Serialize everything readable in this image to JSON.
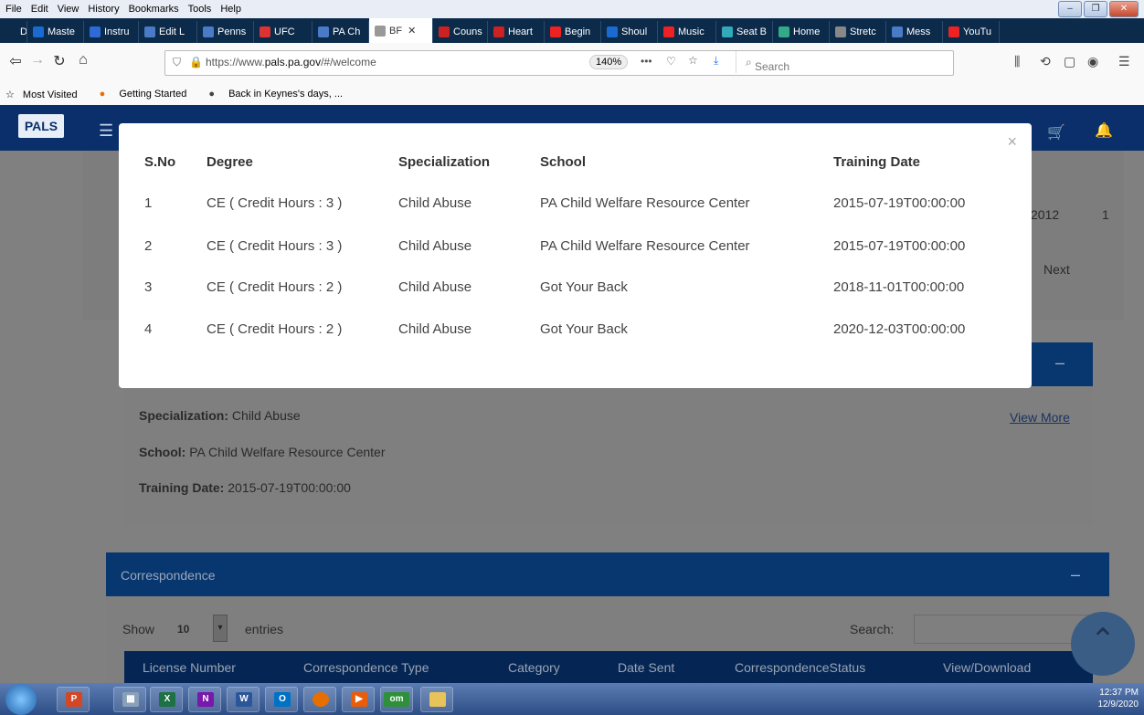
{
  "menu": [
    "File",
    "Edit",
    "View",
    "History",
    "Bookmarks",
    "Tools",
    "Help"
  ],
  "tabs": [
    {
      "label": "DA",
      "color": "#0c2a4a"
    },
    {
      "label": "Maste",
      "color": "#1a6bd1"
    },
    {
      "label": "Instru",
      "color": "#2f6bd6"
    },
    {
      "label": "Edit L",
      "color": "#4a7bc7"
    },
    {
      "label": "Penns",
      "color": "#4a7bc7"
    },
    {
      "label": "UFC",
      "color": "#d33"
    },
    {
      "label": "PA Ch",
      "color": "#4a7bc7"
    },
    {
      "label": "BF",
      "color": "#999",
      "active": true
    },
    {
      "label": "Couns",
      "color": "#c22"
    },
    {
      "label": "Heart",
      "color": "#c22"
    },
    {
      "label": "Begin",
      "color": "#e22"
    },
    {
      "label": "Shoul",
      "color": "#1a6bd1"
    },
    {
      "label": "Music",
      "color": "#e22"
    },
    {
      "label": "Seat B",
      "color": "#3ab"
    },
    {
      "label": "Home",
      "color": "#3a8"
    },
    {
      "label": "Stretc",
      "color": "#888"
    },
    {
      "label": "Mess",
      "color": "#4a7bc7"
    },
    {
      "label": "YouTu",
      "color": "#e22"
    }
  ],
  "browser": {
    "url_prefix": "https://www.",
    "url_host": "pals.pa.gov",
    "url_suffix": "/#/welcome",
    "zoom": "140%",
    "search_placeholder": "Search"
  },
  "bookmarks": [
    "Most Visited",
    "Getting Started",
    "Back in Keynes's days, ..."
  ],
  "app": {
    "logo": "PALS"
  },
  "modal": {
    "headers": [
      "S.No",
      "Degree",
      "Specialization",
      "School",
      "Training Date"
    ],
    "rows": [
      [
        "1",
        "CE ( Credit Hours : 3 )",
        "Child Abuse",
        "PA Child Welfare Resource Center",
        "2015-07-19T00:00:00"
      ],
      [
        "2",
        "CE ( Credit Hours : 3 )",
        "Child Abuse",
        "PA Child Welfare Resource Center",
        "2015-07-19T00:00:00"
      ],
      [
        "3",
        "CE ( Credit Hours : 2 )",
        "Child Abuse",
        "Got Your Back",
        "2018-11-01T00:00:00"
      ],
      [
        "4",
        "CE ( Credit Hours : 2 )",
        "Child Abuse",
        "Got Your Back",
        "2020-12-03T00:00:00"
      ]
    ],
    "close": "×"
  },
  "background": {
    "partial_year": "2012",
    "partial_num": "1",
    "next": "Next",
    "spec_label": "Specialization:",
    "spec_value": "Child Abuse",
    "school_label": "School:",
    "school_value": "PA Child Welfare Resource Center",
    "date_label": "Training Date:",
    "date_value": "2015-07-19T00:00:00",
    "view_more": "View More",
    "correspondence_title": "Correspondence",
    "show_label": "Show",
    "show_value": "10",
    "entries_label": "entries",
    "search_label": "Search:",
    "columns": [
      "License Number",
      "Correspondence Type",
      "Category",
      "Date Sent",
      "CorrespondenceStatus",
      "View/Download"
    ]
  },
  "taskbar": {
    "time": "12:37 PM",
    "date": "12/9/2020"
  }
}
